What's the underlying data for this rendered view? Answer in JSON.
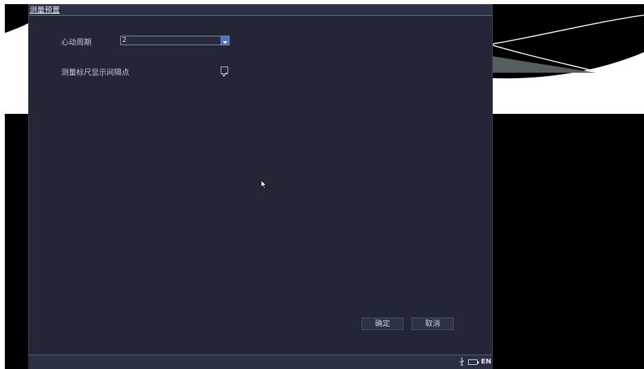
{
  "dialog": {
    "title": "测量预置",
    "heart_cycle_label": "心动周期",
    "heart_cycle_value": "2",
    "caliper_label": "测量标尺显示间隔点",
    "caliper_checked": true,
    "ok_label": "确定",
    "cancel_label": "取消"
  },
  "status": {
    "language": "EN"
  },
  "icons": {
    "dropdown": "chevron-down-icon",
    "check": "check-icon",
    "usb": "usb-icon",
    "battery": "battery-icon",
    "cursor": "mouse-pointer-icon"
  },
  "colors": {
    "dialog_bg": "#232735",
    "accent": "#4d6bd8",
    "statusbar_bg": "#2a3042"
  }
}
